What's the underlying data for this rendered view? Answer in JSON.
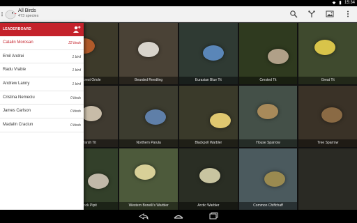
{
  "status": {
    "time": "15:34"
  },
  "app": {
    "title": "All Birds",
    "subtitle": "473 species"
  },
  "actions": [
    {
      "name": "search-icon"
    },
    {
      "name": "tree-icon"
    },
    {
      "name": "image-gallery-icon"
    },
    {
      "name": "overflow-menu-icon"
    }
  ],
  "leaderboard": {
    "title": "LEADERBOARD",
    "players": [
      {
        "name": "Catalin Morosan",
        "score": "22 birds"
      },
      {
        "name": "Emil Andrei",
        "score": "1 bird"
      },
      {
        "name": "Radu Vrabie",
        "score": "1 bird"
      },
      {
        "name": "Andrew Lanny",
        "score": "1 bird"
      },
      {
        "name": "Cristina Nemeciu",
        "score": "0 birds"
      },
      {
        "name": "James Carlson",
        "score": "0 birds"
      },
      {
        "name": "Madalin Craciun",
        "score": "0 birds"
      }
    ]
  },
  "birds": [
    {
      "caption": "Firecrest Oriole",
      "bg": "#3d3a2a",
      "bird": "#b05a2a"
    },
    {
      "caption": "Bearded Reedling",
      "bg": "#4a4236",
      "bird": "#d8d4cc"
    },
    {
      "caption": "Eurasian Blue Tit",
      "bg": "#2f3a33",
      "bird": "#5a86b8"
    },
    {
      "caption": "Crested Tit",
      "bg": "#2f3a1f",
      "bird": "#b0a088"
    },
    {
      "caption": "Great Tit",
      "bg": "#3f4a2e",
      "bird": "#d8c44a"
    },
    {
      "caption": "Marsh Tit",
      "bg": "#3f3a30",
      "bird": "#c8bca8"
    },
    {
      "caption": "Northern Parula",
      "bg": "#3c3c2f",
      "bird": "#5f7fa8"
    },
    {
      "caption": "Blackpoll Warbler",
      "bg": "#3a3a2a",
      "bird": "#e0c870"
    },
    {
      "caption": "House Sparrow",
      "bg": "#445048",
      "bird": "#a88a5a"
    },
    {
      "caption": "Tree Sparrow",
      "bg": "#3a3227",
      "bird": "#8a6a44"
    },
    {
      "caption": "Rock Pipit",
      "bg": "#33402a",
      "bird": "#c0b8a8"
    },
    {
      "caption": "Western Bonelli's Warbler",
      "bg": "#4d5a3b",
      "bird": "#d8d098"
    },
    {
      "caption": "Arctic Warbler",
      "bg": "#2a2e24",
      "bird": "#c8c4a0"
    },
    {
      "caption": "Common Chiffchaff",
      "bg": "#4b5a5e",
      "bird": "#9a8a50"
    }
  ]
}
